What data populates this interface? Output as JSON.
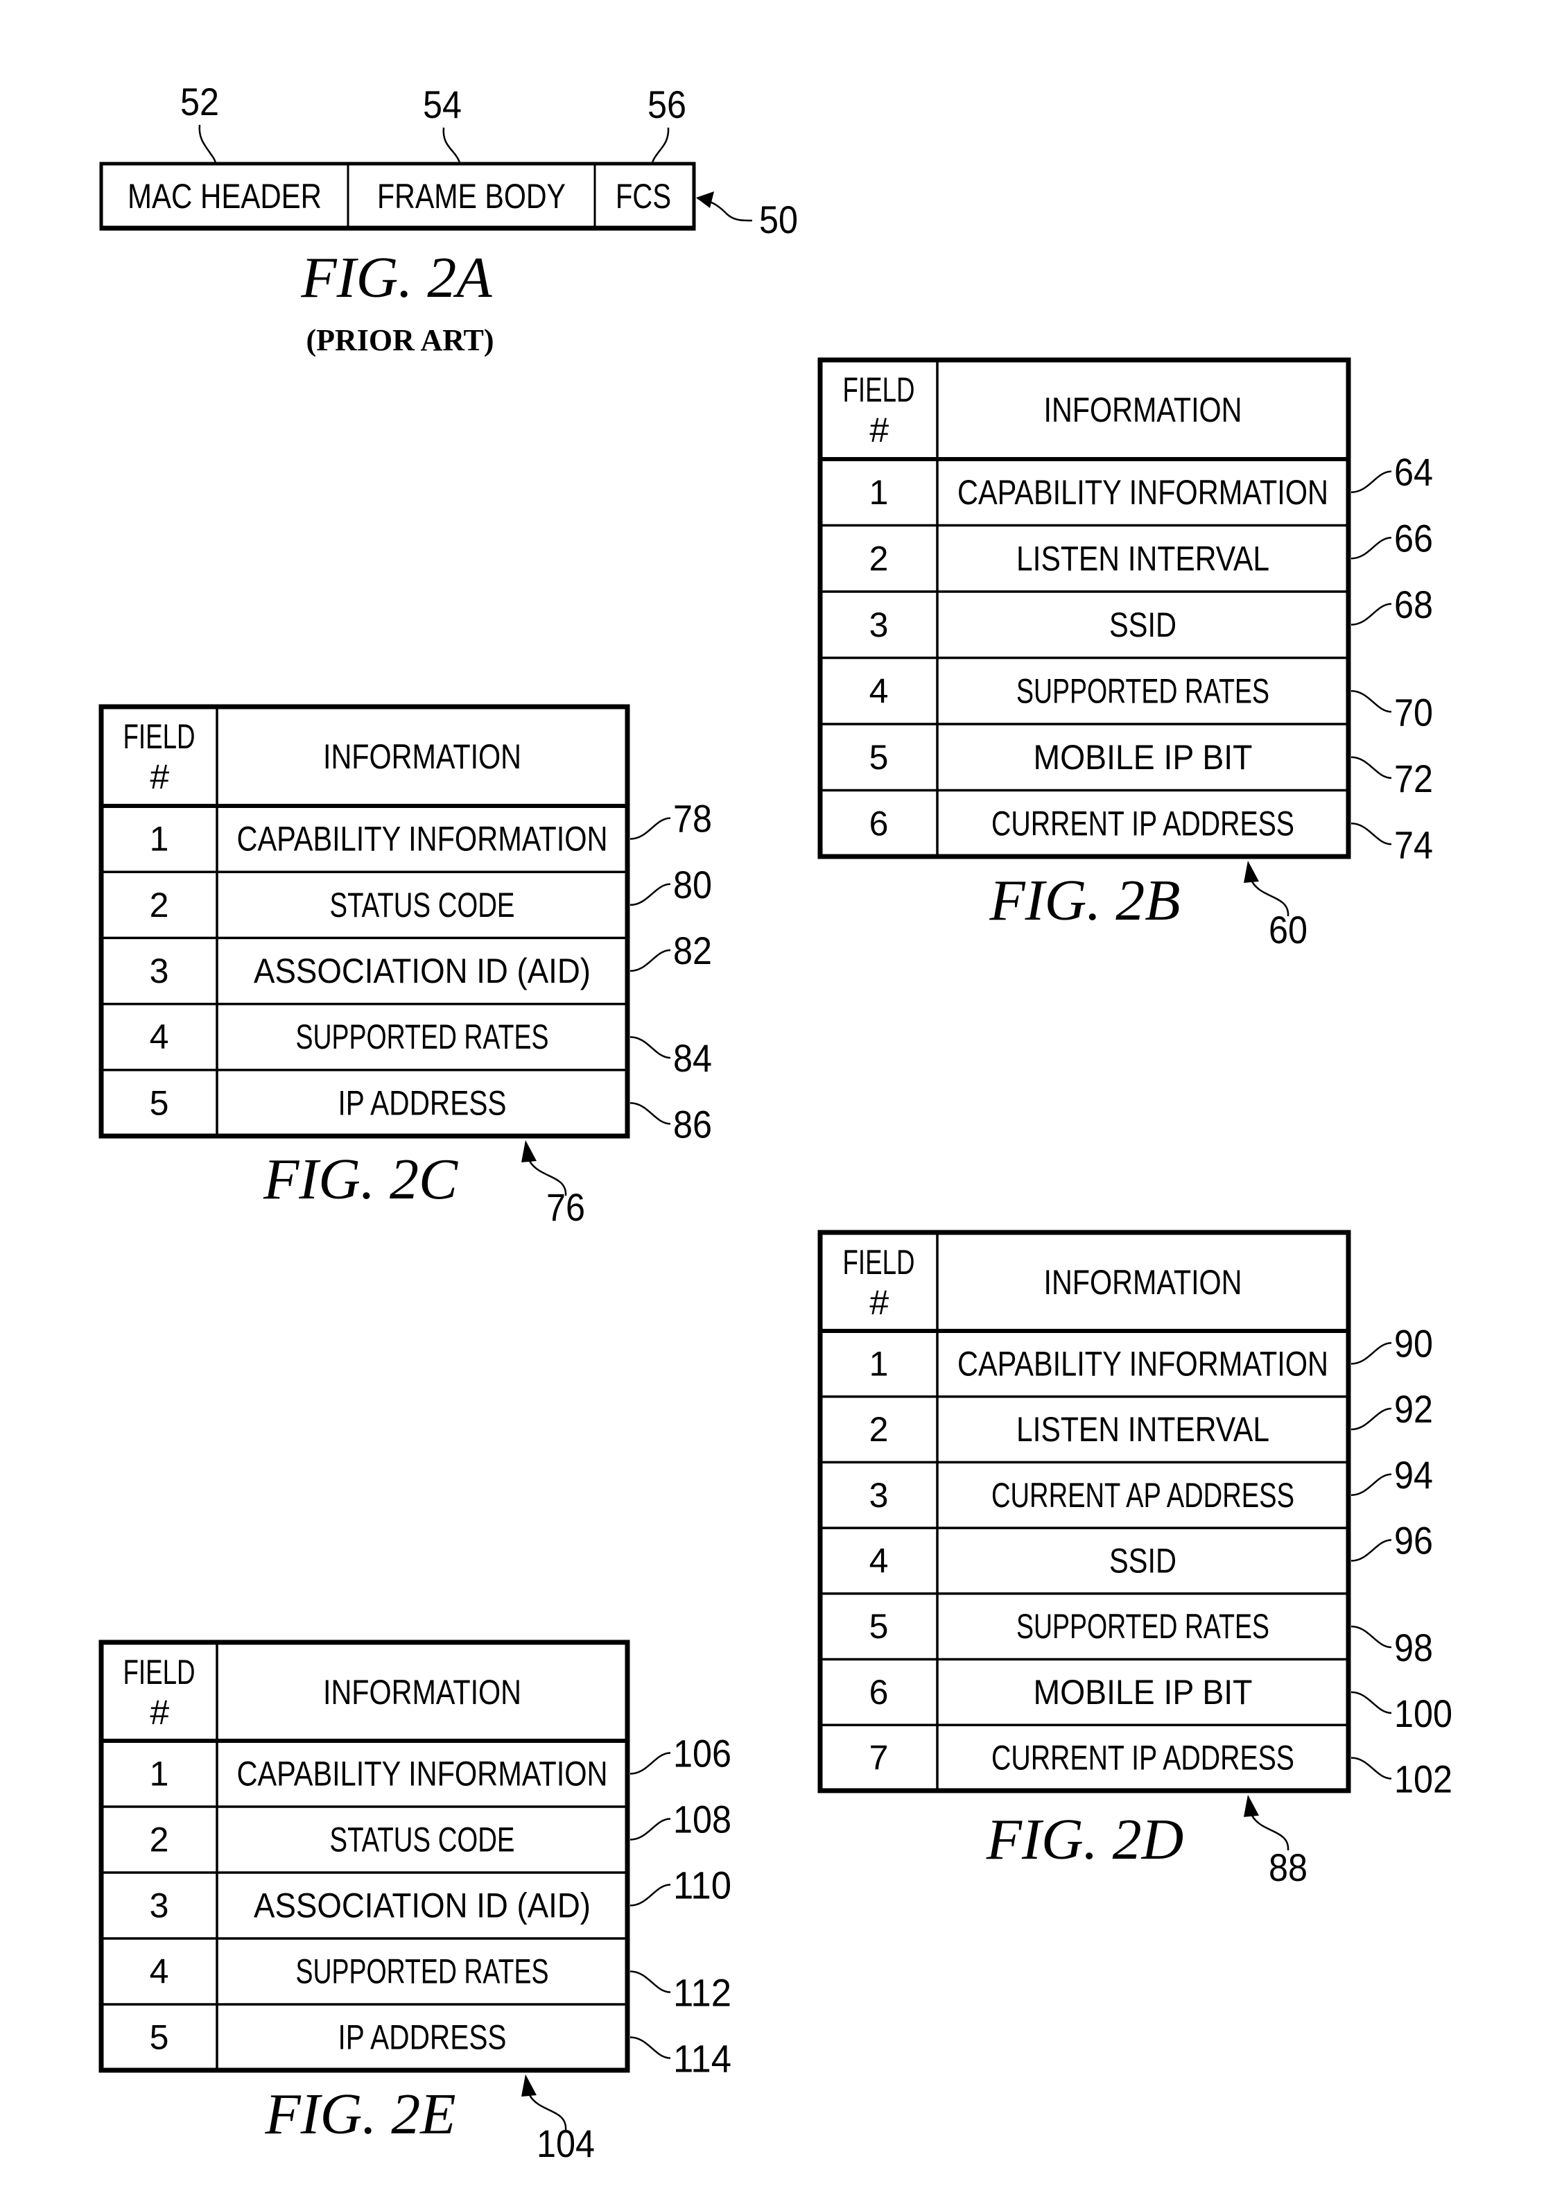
{
  "fig2a": {
    "segments": [
      {
        "label": "MAC HEADER",
        "ref": "52"
      },
      {
        "label": "FRAME BODY",
        "ref": "54"
      },
      {
        "label": "FCS",
        "ref": "56"
      }
    ],
    "frame_ref": "50",
    "caption": "FIG. 2A",
    "subcaption": "(PRIOR ART)"
  },
  "tables": [
    {
      "id": "2B",
      "caption": "FIG. 2B",
      "table_ref": "60",
      "header": {
        "field_line1": "FIELD",
        "field_line2": "#",
        "info": "INFORMATION"
      },
      "rows": [
        {
          "num": "1",
          "info": "CAPABILITY INFORMATION",
          "ref": "64"
        },
        {
          "num": "2",
          "info": "LISTEN INTERVAL",
          "ref": "66"
        },
        {
          "num": "3",
          "info": "SSID",
          "ref": "68"
        },
        {
          "num": "4",
          "info": "SUPPORTED RATES",
          "ref": "70"
        },
        {
          "num": "5",
          "info": "MOBILE IP BIT",
          "ref": "72"
        },
        {
          "num": "6",
          "info": "CURRENT IP ADDRESS",
          "ref": "74"
        }
      ]
    },
    {
      "id": "2C",
      "caption": "FIG. 2C",
      "table_ref": "76",
      "header": {
        "field_line1": "FIELD",
        "field_line2": "#",
        "info": "INFORMATION"
      },
      "rows": [
        {
          "num": "1",
          "info": "CAPABILITY INFORMATION",
          "ref": "78"
        },
        {
          "num": "2",
          "info": "STATUS CODE",
          "ref": "80"
        },
        {
          "num": "3",
          "info": "ASSOCIATION ID (AID)",
          "ref": "82"
        },
        {
          "num": "4",
          "info": "SUPPORTED RATES",
          "ref": "84"
        },
        {
          "num": "5",
          "info": "IP ADDRESS",
          "ref": "86"
        }
      ]
    },
    {
      "id": "2D",
      "caption": "FIG. 2D",
      "table_ref": "88",
      "header": {
        "field_line1": "FIELD",
        "field_line2": "#",
        "info": "INFORMATION"
      },
      "rows": [
        {
          "num": "1",
          "info": "CAPABILITY INFORMATION",
          "ref": "90"
        },
        {
          "num": "2",
          "info": "LISTEN INTERVAL",
          "ref": "92"
        },
        {
          "num": "3",
          "info": "CURRENT AP ADDRESS",
          "ref": "94"
        },
        {
          "num": "4",
          "info": "SSID",
          "ref": "96"
        },
        {
          "num": "5",
          "info": "SUPPORTED RATES",
          "ref": "98"
        },
        {
          "num": "6",
          "info": "MOBILE IP BIT",
          "ref": "100"
        },
        {
          "num": "7",
          "info": "CURRENT IP ADDRESS",
          "ref": "102"
        }
      ]
    },
    {
      "id": "2E",
      "caption": "FIG. 2E",
      "table_ref": "104",
      "header": {
        "field_line1": "FIELD",
        "field_line2": "#",
        "info": "INFORMATION"
      },
      "rows": [
        {
          "num": "1",
          "info": "CAPABILITY INFORMATION",
          "ref": "106"
        },
        {
          "num": "2",
          "info": "STATUS CODE",
          "ref": "108"
        },
        {
          "num": "3",
          "info": "ASSOCIATION ID (AID)",
          "ref": "110"
        },
        {
          "num": "4",
          "info": "SUPPORTED RATES",
          "ref": "112"
        },
        {
          "num": "5",
          "info": "IP ADDRESS",
          "ref": "114"
        }
      ]
    }
  ]
}
